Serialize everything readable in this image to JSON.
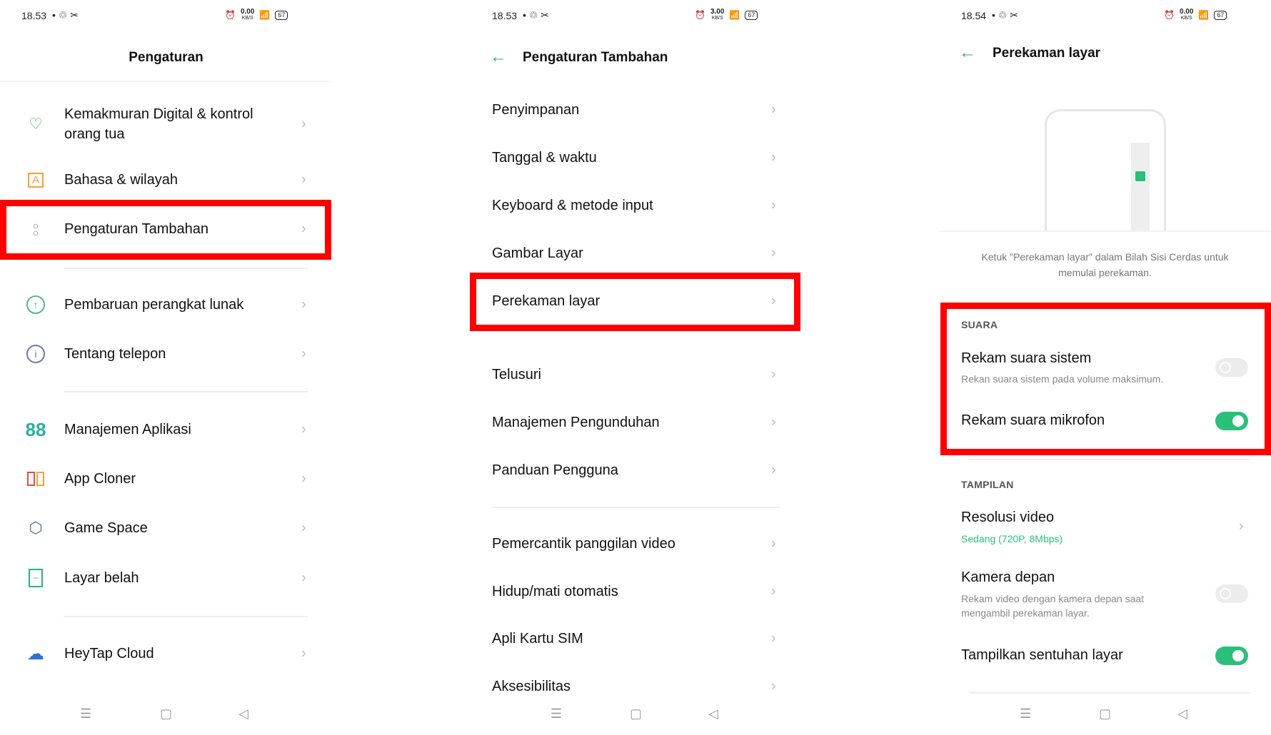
{
  "colors": {
    "accent": "#2bc07a",
    "highlight": "#ff0000"
  },
  "panel1": {
    "status": {
      "time": "18.53",
      "speed": "0.00",
      "speed_unit": "KB/S",
      "battery": "67"
    },
    "title": "Pengaturan",
    "items": [
      {
        "label": "Kemakmuran Digital & kontrol orang tua",
        "icon": "digital-wellbeing-icon"
      },
      {
        "label": "Bahasa & wilayah",
        "icon": "language-icon"
      },
      {
        "label": "Pengaturan Tambahan",
        "icon": "additional-settings-icon"
      },
      {
        "label": "Pembaruan perangkat lunak",
        "icon": "software-update-icon"
      },
      {
        "label": "Tentang telepon",
        "icon": "info-icon"
      },
      {
        "label": "Manajemen Aplikasi",
        "icon": "apps-icon"
      },
      {
        "label": "App Cloner",
        "icon": "app-cloner-icon"
      },
      {
        "label": "Game Space",
        "icon": "game-space-icon"
      },
      {
        "label": "Layar belah",
        "icon": "split-screen-icon"
      },
      {
        "label": "HeyTap Cloud",
        "icon": "cloud-icon"
      }
    ]
  },
  "panel2": {
    "status": {
      "time": "18.53",
      "speed": "3.00",
      "speed_unit": "KB/S",
      "battery": "67"
    },
    "title": "Pengaturan Tambahan",
    "items": [
      "Penyimpanan",
      "Tanggal & waktu",
      "Keyboard & metode input",
      "Gambar Layar",
      "Perekaman layar",
      "Telusuri",
      "Manajemen Pengunduhan",
      "Panduan Pengguna",
      "Pemercantik panggilan video",
      "Hidup/mati otomatis",
      "Apli Kartu SIM",
      "Aksesibilitas"
    ]
  },
  "panel3": {
    "status": {
      "time": "18.54",
      "speed": "0.00",
      "speed_unit": "KB/S",
      "battery": "67"
    },
    "title": "Perekaman layar",
    "caption": "Ketuk \"Perekaman layar\" dalam Bilah Sisi Cerdas untuk memulai perekaman.",
    "sound_header": "SUARA",
    "system_sound": {
      "label": "Rekam suara sistem",
      "desc": "Rekan suara sistem pada volume maksimum.",
      "on": false
    },
    "mic": {
      "label": "Rekam suara mikrofon",
      "on": true
    },
    "display_header": "TAMPILAN",
    "resolution": {
      "label": "Resolusi video",
      "value": "Sedang (720P, 8Mbps)"
    },
    "front_camera": {
      "label": "Kamera depan",
      "desc": "Rekam video dengan kamera depan saat mengambil perekaman layar.",
      "on": false
    },
    "touches": {
      "label": "Tampilkan sentuhan layar",
      "on": true
    }
  }
}
